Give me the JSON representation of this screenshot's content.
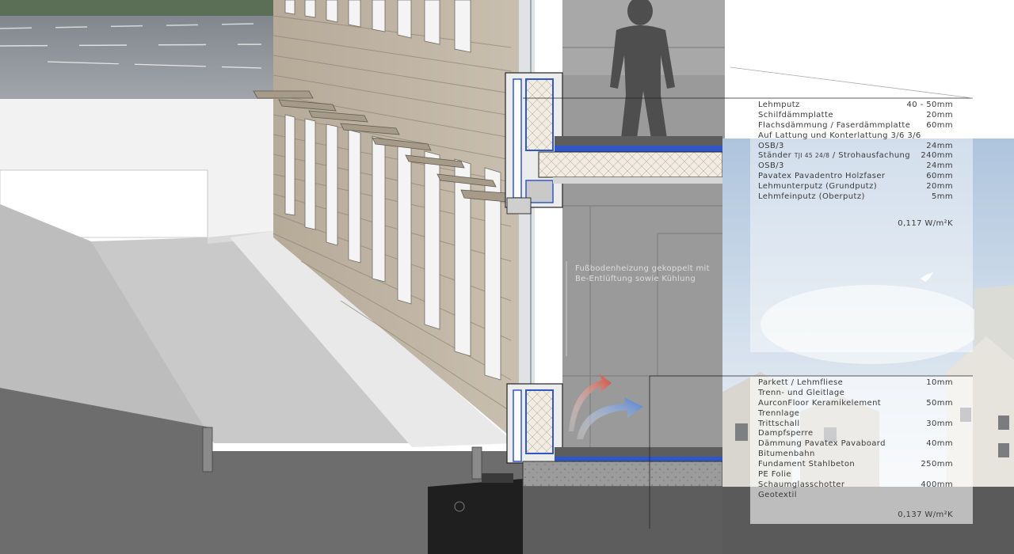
{
  "wall_layers": [
    {
      "label": "Lehmputz",
      "value": "40 - 50mm"
    },
    {
      "label": "Schilfdämmplatte",
      "value": "20mm"
    },
    {
      "label": "Flachsdämmung / Faserdämmplatte",
      "value": "60mm"
    },
    {
      "label": "Auf Lattung und Konterlattung 3/6 3/6",
      "value": ""
    },
    {
      "label": "OSB/3",
      "value": "24mm"
    },
    {
      "label": "Ständer",
      "sublabel": "TJI 45 24/8",
      "label_suffix": " / Strohausfachung",
      "value": "240mm"
    },
    {
      "label": "OSB/3",
      "value": "24mm"
    },
    {
      "label": "Pavatex Pavadentro Holzfaser",
      "value": "60mm"
    },
    {
      "label": "Lehmunterputz (Grundputz)",
      "value": "20mm"
    },
    {
      "label": "Lehmfeinputz (Oberputz)",
      "value": "5mm"
    }
  ],
  "wall_u_value": "0,117 W/m²K",
  "floor_layers": [
    {
      "label": "Parkett / Lehmfliese",
      "value": "10mm"
    },
    {
      "label": "Trenn- und Gleitlage",
      "value": ""
    },
    {
      "label": "AurconFloor Keramikelement",
      "value": "50mm"
    },
    {
      "label": "Trennlage",
      "value": ""
    },
    {
      "label": "Trittschall",
      "value": "30mm"
    },
    {
      "label": "Dampfsperre",
      "value": ""
    },
    {
      "label": "Dämmung Pavatex Pavaboard",
      "value": "40mm"
    },
    {
      "label": "Bitumenbahn",
      "value": ""
    },
    {
      "label": "Fundament Stahlbeton",
      "value": "250mm"
    },
    {
      "label": "PE Folie",
      "value": ""
    },
    {
      "label": "Schaumglasschotter",
      "value": "400mm"
    },
    {
      "label": "Geotextil",
      "value": ""
    }
  ],
  "floor_u_value": "0,137 W/m²K",
  "annotation": {
    "line1": "Fußbodenheizung gekoppelt mit",
    "line2": "Be-Entlüftung sowie Kühlung"
  },
  "colors": {
    "insulation_blue": "#2f57c8",
    "heat_red": "#d24a3a",
    "cool_blue": "#4f7fd0",
    "sky": "#c8d6e6"
  }
}
